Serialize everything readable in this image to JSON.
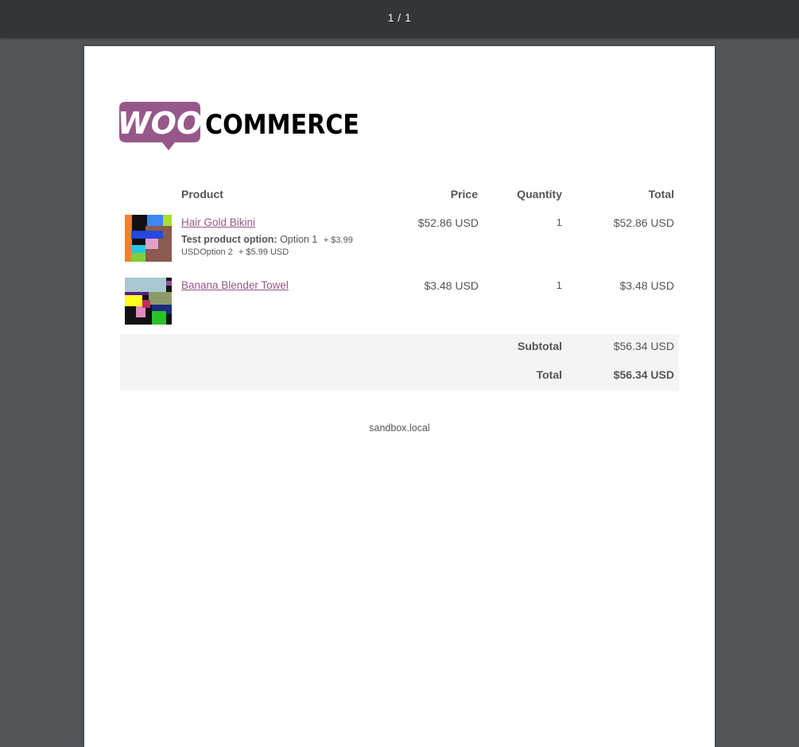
{
  "viewer": {
    "page_counter": "1 / 1"
  },
  "brand": {
    "logo_bubble_text": "WOO",
    "logo_text": "COMMERCE",
    "accent_color": "#96588a"
  },
  "table": {
    "headers": {
      "product": "Product",
      "price": "Price",
      "quantity": "Quantity",
      "total": "Total"
    },
    "rows": [
      {
        "name": "Hair Gold Bikini",
        "price": "$52.86 USD",
        "quantity": "1",
        "total": "$52.86 USD",
        "meta": {
          "key": "Test product option:",
          "option1": "Option 1",
          "option1_price": "+ $3.99",
          "option1_currency": "USD",
          "option2": "Option 2",
          "option2_price": "+ $5.99 USD"
        }
      },
      {
        "name": "Banana Blender Towel",
        "price": "$3.48 USD",
        "quantity": "1",
        "total": "$3.48 USD"
      }
    ]
  },
  "totals": {
    "subtotal_label": "Subtotal",
    "subtotal_value": "$56.34 USD",
    "total_label": "Total",
    "total_value": "$56.34 USD"
  },
  "footer": {
    "site": "sandbox.local"
  }
}
